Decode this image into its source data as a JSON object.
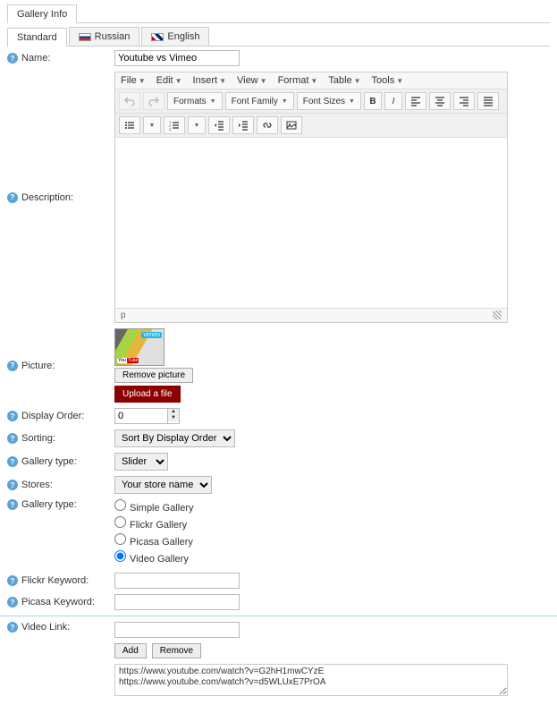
{
  "main_tab": {
    "label": "Gallery Info"
  },
  "lang_tabs": {
    "standard": "Standard",
    "russian": "Russian",
    "english": "English"
  },
  "labels": {
    "name": "Name:",
    "description": "Description:",
    "picture": "Picture:",
    "display_order": "Display Order:",
    "sorting": "Sorting:",
    "gallery_type": "Gallery type:",
    "stores": "Stores:",
    "gallery_type2": "Gallery type:",
    "flickr_keyword": "Flickr Keyword:",
    "picasa_keyword": "Picasa Keyword:",
    "video_link": "Video Link:"
  },
  "values": {
    "name": "Youtube vs Vimeo",
    "display_order": "0",
    "sorting": "Sort By Display Order",
    "gallery_dd": "Slider",
    "stores": "Your store name",
    "flickr_keyword": "",
    "picasa_keyword": "",
    "video_input": ""
  },
  "editor": {
    "menu": {
      "file": "File",
      "edit": "Edit",
      "insert": "Insert",
      "view": "View",
      "format": "Format",
      "table": "Table",
      "tools": "Tools"
    },
    "toolbar": {
      "formats": "Formats",
      "font_family": "Font Family",
      "font_sizes": "Font Sizes",
      "bold": "B",
      "italic": "I"
    },
    "status": "p"
  },
  "picture_actions": {
    "remove": "Remove picture",
    "upload": "Upload a file"
  },
  "radio": {
    "simple": "Simple Gallery",
    "flickr": "Flickr Gallery",
    "picasa": "Picasa Gallery",
    "video": "Video Gallery",
    "selected": "video"
  },
  "video_btns": {
    "add": "Add",
    "remove": "Remove"
  },
  "video_links": [
    "https://www.youtube.com/watch?v=G2hH1mwCYzE",
    "https://www.youtube.com/watch?v=d5WLUxE7PrOA"
  ]
}
